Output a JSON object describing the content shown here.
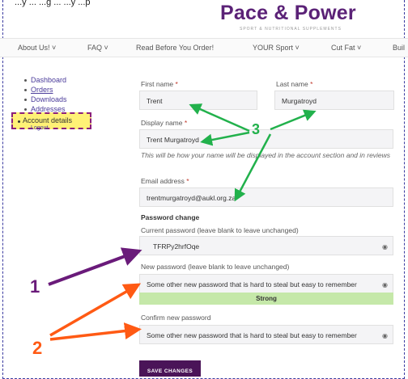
{
  "page": {
    "top_line": "...y ... ...g ... ...y ...p",
    "brand": "Pace & Power",
    "tagline": "SPORT & NUTRITIONAL SUPPLEMENTS"
  },
  "nav": {
    "items": [
      "About Us!",
      "FAQ",
      "Read Before You Order!",
      "YOUR Sport",
      "Cut Fat",
      "Buil"
    ]
  },
  "sidebar": {
    "items": [
      "Dashboard",
      "Orders",
      "Downloads",
      "Addresses",
      "Account details",
      "Logout"
    ]
  },
  "form": {
    "first_name_label": "First name",
    "first_name_value": "Trent",
    "last_name_label": "Last name",
    "last_name_value": "Murgatroyd",
    "display_name_label": "Display name",
    "display_name_value": "Trent Murgatroyd",
    "display_name_hint": "This will be how your name will be displayed in the account section and in reviews",
    "email_label": "Email address",
    "email_value": "trentmurgatroyd@aukl.org.za",
    "required_mark": "*",
    "password_section_title": "Password change",
    "current_password_label": "Current password (leave blank to leave unchanged)",
    "current_password_value": "TFRPy2hrfOqe",
    "new_password_label": "New password (leave blank to leave unchanged)",
    "new_password_value": "Some other new password that is hard to steal but easy to remember",
    "strength_text": "Strong",
    "confirm_password_label": "Confirm new password",
    "confirm_password_value": "Some other new password that is hard to steal but easy to remember",
    "save_button": "SAVE CHANGES"
  },
  "annotations": {
    "one": "1",
    "two": "2",
    "three": "3",
    "color_one": "#6a1b7a",
    "color_two": "#ff5a14",
    "color_three": "#22b14c"
  },
  "icons": {
    "chevron": "˅",
    "eye": "◉"
  }
}
